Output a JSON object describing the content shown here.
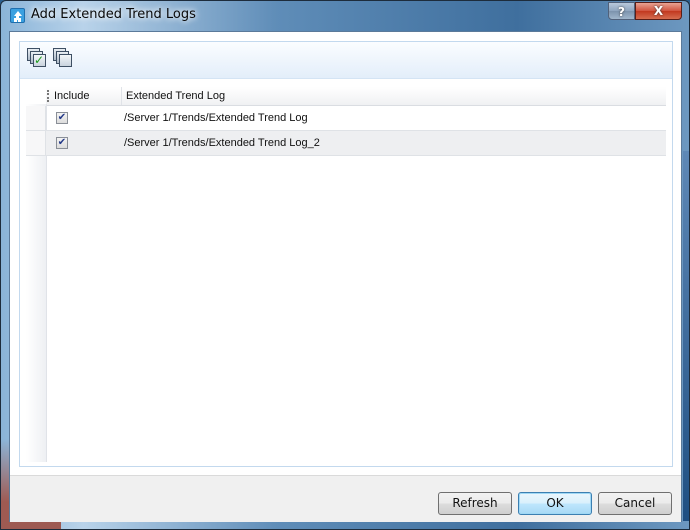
{
  "window": {
    "title": "Add Extended Trend Logs",
    "help_label": "?",
    "close_label": "X"
  },
  "toolbar": {
    "buttons": [
      {
        "name": "select-all",
        "icon": "select-all-icon",
        "glyph": "✓"
      },
      {
        "name": "deselect-all",
        "icon": "deselect-all-icon"
      }
    ]
  },
  "grid": {
    "columns": [
      {
        "label": "Include"
      },
      {
        "label": "Extended Trend Log"
      }
    ],
    "rows": [
      {
        "include": true,
        "check_glyph": "✔",
        "path": "/Server 1/Trends/Extended Trend Log"
      },
      {
        "include": true,
        "check_glyph": "✔",
        "path": "/Server 1/Trends/Extended Trend Log_2"
      }
    ]
  },
  "footer": {
    "refresh_label": "Refresh",
    "ok_label": "OK",
    "cancel_label": "Cancel"
  }
}
